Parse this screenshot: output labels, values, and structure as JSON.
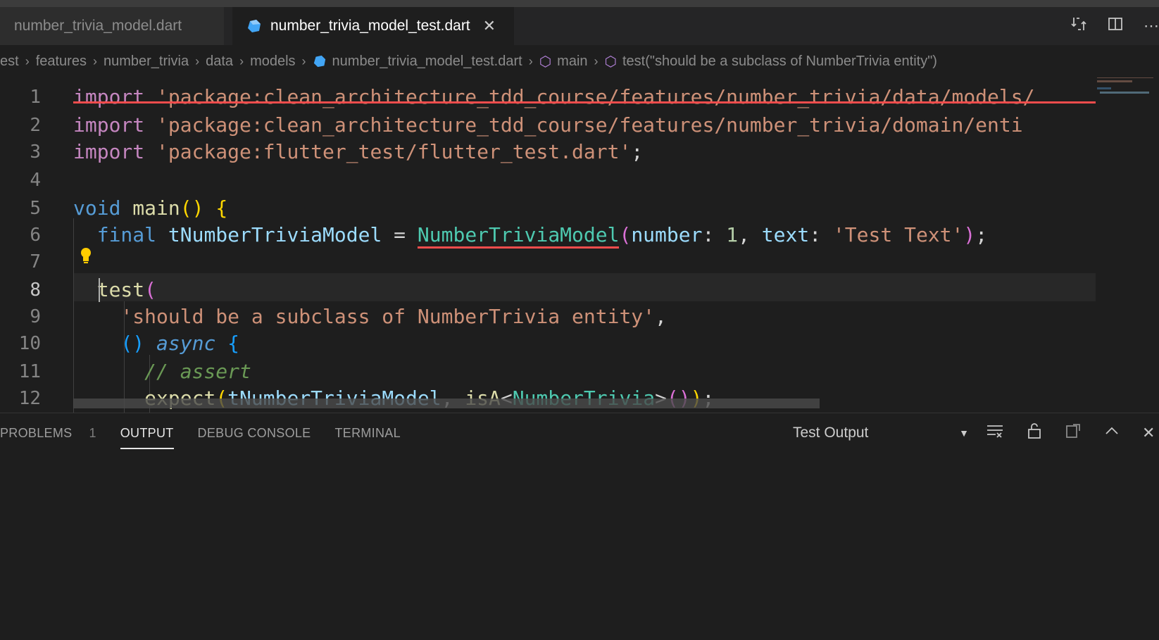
{
  "tabs": [
    {
      "label": "number_trivia_model.dart",
      "active": false
    },
    {
      "label": "number_trivia_model_test.dart",
      "active": true
    }
  ],
  "breadcrumb": [
    "test",
    "features",
    "number_trivia",
    "data",
    "models",
    "number_trivia_model_test.dart",
    "main",
    "test(\"should be a subclass of NumberTrivia entity\")"
  ],
  "breadcrumb_visible": [
    "est",
    "features",
    "number_trivia",
    "data",
    "models",
    "number_trivia_model_test.dart",
    "main",
    "test(\"should be a subclass of NumberTrivia entity\")"
  ],
  "editor": {
    "line_numbers": [
      "1",
      "2",
      "3",
      "4",
      "5",
      "6",
      "7",
      "8",
      "9",
      "10",
      "11",
      "12"
    ],
    "lines": [
      "import 'package:clean_architecture_tdd_course/features/number_trivia/data/models/",
      "import 'package:clean_architecture_tdd_course/features/number_trivia/domain/enti",
      "import 'package:flutter_test/flutter_test.dart';",
      "",
      "void main() {",
      "  final tNumberTriviaModel = NumberTriviaModel(number: 1, text: 'Test Text');",
      "",
      "  test(",
      "    'should be a subclass of NumberTrivia entity',",
      "    () async {",
      "      // assert",
      "      expect(tNumberTriviaModel, isA<NumberTrivia>());"
    ]
  },
  "panel": {
    "tabs": [
      "PROBLEMS",
      "OUTPUT",
      "DEBUG CONSOLE",
      "TERMINAL"
    ],
    "problems_count": "1",
    "active_tab": "OUTPUT",
    "output_channel": "Test Output"
  },
  "icons": {
    "tab_actions": [
      "compare-changes-icon",
      "split-editor-icon",
      "more-actions-icon"
    ],
    "panel_actions": [
      "clear-output-icon",
      "lock-scroll-icon",
      "open-log-icon",
      "maximize-panel-icon",
      "close-panel-icon"
    ]
  },
  "colors": {
    "keyword": "#569cd6",
    "string": "#ce9178",
    "function": "#dcdcaa",
    "class": "#4ec9b0",
    "error_underline": "#f14c4c"
  }
}
